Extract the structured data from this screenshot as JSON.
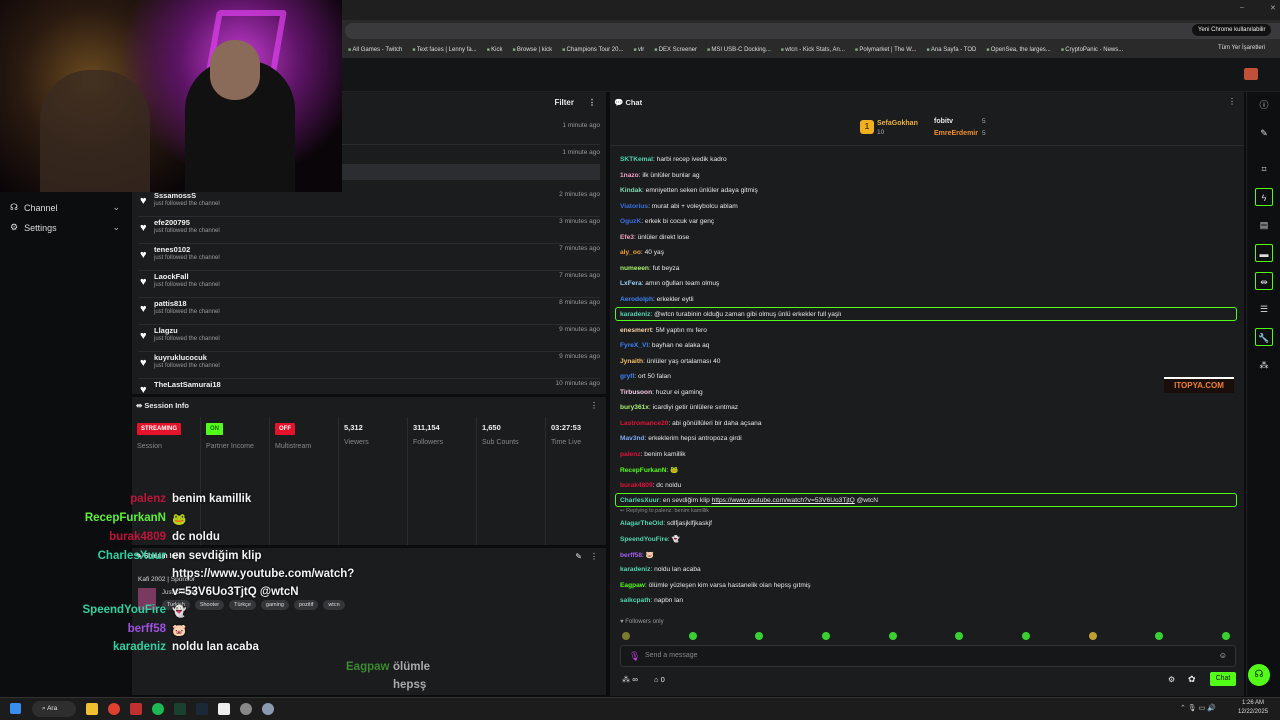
{
  "browser": {
    "update_button": "Yeni Chrome kullanılabilir",
    "bookmarks": [
      "All Games - Twitch",
      "Text faces | Lenny fa...",
      "Kick",
      "Browse | kick",
      "Champions Tour 20...",
      "vlr",
      "DEX Screener",
      "MSI USB-C Docking...",
      "wtcn - Kick Stats, An...",
      "Polymarket | The W...",
      "Ana Sayfa - TOD",
      "OpenSea, the larges...",
      "CryptoPanic - News..."
    ],
    "all_bookmarks": "Tüm Yer İşaretleri"
  },
  "sidebar": {
    "items": [
      {
        "label": "Channel",
        "icon": "broadcast-icon"
      },
      {
        "label": "Settings",
        "icon": "gear-icon"
      }
    ]
  },
  "feed": {
    "filter": "Filter",
    "top_times": [
      "1 minute ago",
      "1 minute ago"
    ],
    "items": [
      {
        "name": "SssamossS",
        "sub": "just followed the channel",
        "time": "2 minutes ago"
      },
      {
        "name": "efe200795",
        "sub": "just followed the channel",
        "time": "3 minutes ago"
      },
      {
        "name": "tenes0102",
        "sub": "just followed the channel",
        "time": "7 minutes ago"
      },
      {
        "name": "LaockFall",
        "sub": "just followed the channel",
        "time": "7 minutes ago"
      },
      {
        "name": "pattis818",
        "sub": "just followed the channel",
        "time": "8 minutes ago"
      },
      {
        "name": "Llagzu",
        "sub": "just followed the channel",
        "time": "9 minutes ago"
      },
      {
        "name": "kuyruklucocuk",
        "sub": "just followed the channel",
        "time": "9 minutes ago"
      },
      {
        "name": "TheLastSamurai18",
        "sub": "",
        "time": "10 minutes ago"
      }
    ]
  },
  "session": {
    "title": "Session Info",
    "badges": [
      {
        "text": "STREAMING",
        "label": "Session",
        "color": "#e5132a"
      },
      {
        "text": "ON",
        "label": "Partner Income",
        "color": "#53fc18"
      },
      {
        "text": "OFF",
        "label": "Multistream",
        "color": "#e5132a"
      }
    ],
    "stats": [
      {
        "value": "5,312",
        "label": "Viewers"
      },
      {
        "value": "311,154",
        "label": "Followers"
      },
      {
        "value": "1,650",
        "label": "Sub Counts"
      },
      {
        "value": "03:27:53",
        "label": "Time Live"
      }
    ]
  },
  "stream_info": {
    "title": "Stream Info",
    "line1": "Kafi 2002 | Sponsor",
    "line2": "Just Chatting",
    "tags": [
      "Turkish",
      "Shooter",
      "Türkçe",
      "gaming",
      "pozitif",
      "wtcn"
    ]
  },
  "chat": {
    "title": "Chat",
    "leaderboard": [
      {
        "rank": "1",
        "name": "SefaGokhan",
        "count": "10"
      },
      {
        "name": "fobitv",
        "count": "5"
      },
      {
        "name": "EmreErdemir",
        "count": "5"
      }
    ],
    "messages": [
      {
        "user": "SKTKemal",
        "color": "#4fd6b0",
        "text": "harbi recep ivedik kadro"
      },
      {
        "user": "1nazo",
        "color": "#f0a0c8",
        "text": "ilk ünlüler bunlar ag"
      },
      {
        "user": "Kindak",
        "color": "#7ed9b0",
        "text": "emniyetten seken ünlüler adaya gitmiş"
      },
      {
        "user": "Viatorius",
        "color": "#3b6fe0",
        "text": "murat abi + voleybolcu ablam"
      },
      {
        "user": "OguzK",
        "color": "#3b6fe0",
        "text": "erkek bi cocuk var genç"
      },
      {
        "user": "Efe3",
        "color": "#f2a0c0",
        "text": "ünlüler direkt lose"
      },
      {
        "user": "aly_oo",
        "color": "#f0a030",
        "text": "40 yaş"
      },
      {
        "user": "numeeen",
        "color": "#a6f06a",
        "text": "fut beyza"
      },
      {
        "user": "LxFera",
        "color": "#9ad0f5",
        "text": "amın oğulları team olmuş"
      },
      {
        "user": "Aerodolph",
        "color": "#3b82f6",
        "text": "erkekler eytli"
      },
      {
        "user": "karadeniz",
        "color": "#4fd6b0",
        "text": "@wtcn turabinin olduğu zaman gibi olmuş ünlü erkekler full yaşlı",
        "highlight": true
      },
      {
        "user": "enesmerrt",
        "color": "#f5d0a0",
        "text": "5M yaptın mı fero"
      },
      {
        "user": "FyreX_Vl",
        "color": "#3b82f6",
        "text": "bayhan ne alaka aq"
      },
      {
        "user": "Jynaith",
        "color": "#f0c060",
        "text": "ünlüler yaş ortalaması 40"
      },
      {
        "user": "gryfl",
        "color": "#3b82f6",
        "text": "ort 50 falan"
      },
      {
        "user": "Tirbusoon",
        "color": "#f0c8e0",
        "text": "huzur ei gaming"
      },
      {
        "user": "bury361x",
        "color": "#a6f06a",
        "text": "icardiyi getir ünlülere sıntmaz"
      },
      {
        "user": "Lastromance20",
        "color": "#e0133a",
        "text": "abi gönüllüleri bir daha açsana"
      },
      {
        "user": "Mav3nd",
        "color": "#7aa8f0",
        "text": "erkeklerim hepsi antropoza girdi"
      },
      {
        "user": "palenz",
        "color": "#e0133a",
        "text": "benim kamillik"
      },
      {
        "user": "RecepFurkanN",
        "color": "#53fc18",
        "text": "🐸"
      },
      {
        "user": "burak4809",
        "color": "#e0133a",
        "text": "dc noldu"
      },
      {
        "user": "CharlesXuur",
        "color": "#4fd6b0",
        "text": "en sevdiğim klip",
        "link": "https://www.youtube.com/watch?v=53V6Uo3TjtQ",
        "after": " @wtcN",
        "highlight": true
      },
      {
        "reply": "Replying to palenz: benim kamillik"
      },
      {
        "user": "AlagarTheOld",
        "color": "#4fd6b0",
        "text": "sdlfjasjklfjkaskjf"
      },
      {
        "user": "SpeendYouFire",
        "color": "#4fd6b0",
        "text": "👻"
      },
      {
        "user": "berff58",
        "color": "#a060f0",
        "text": "🐷"
      },
      {
        "user": "karadeniz",
        "color": "#4fd6b0",
        "text": "noldu lan acaba"
      },
      {
        "user": "Eagpaw",
        "color": "#53fc18",
        "text": "ölümle yüzleşen kim varsa hastanelik olan hepsş gıtmiş"
      },
      {
        "user": "saikcpath",
        "color": "#4fd6b0",
        "text": "napbn lan"
      }
    ],
    "followers_only": "Followers only",
    "input_placeholder": "Send a message",
    "points": "∞",
    "gifts": "0",
    "send": "Chat"
  },
  "overlay": [
    {
      "user": "palenz",
      "color": "#c0143c",
      "text": "benim kamillik"
    },
    {
      "user": "RecepFurkanN",
      "color": "#5df03a",
      "text": "🐸"
    },
    {
      "user": "burak4809",
      "color": "#c0143c",
      "text": "dc noldu"
    },
    {
      "user": "CharlesXuur",
      "color": "#30d0a0",
      "text": "en sevdiğim klip"
    },
    {
      "user": "",
      "text": "https://www.youtube.com/watch?"
    },
    {
      "user": "",
      "text": "v=53V6Uo3TjtQ @wtcN"
    },
    {
      "user": "SpeendYouFire",
      "color": "#30d0a0",
      "text": "👻"
    },
    {
      "user": "berff58",
      "color": "#a050e0",
      "text": "🐷"
    },
    {
      "user": "karadeniz",
      "color": "#30d0a0",
      "text": "noldu lan acaba"
    }
  ],
  "overlay_tail": {
    "user": "Eagpaw",
    "line1": "ölümle",
    "line2": "hepsş"
  },
  "sponsor_logo": "ITOPYA.COM",
  "taskbar": {
    "search": "Ara",
    "time": "1:26 AM",
    "date": "12/22/2025"
  },
  "colors": {
    "accent": "#53fc18",
    "danger": "#e5132a"
  }
}
